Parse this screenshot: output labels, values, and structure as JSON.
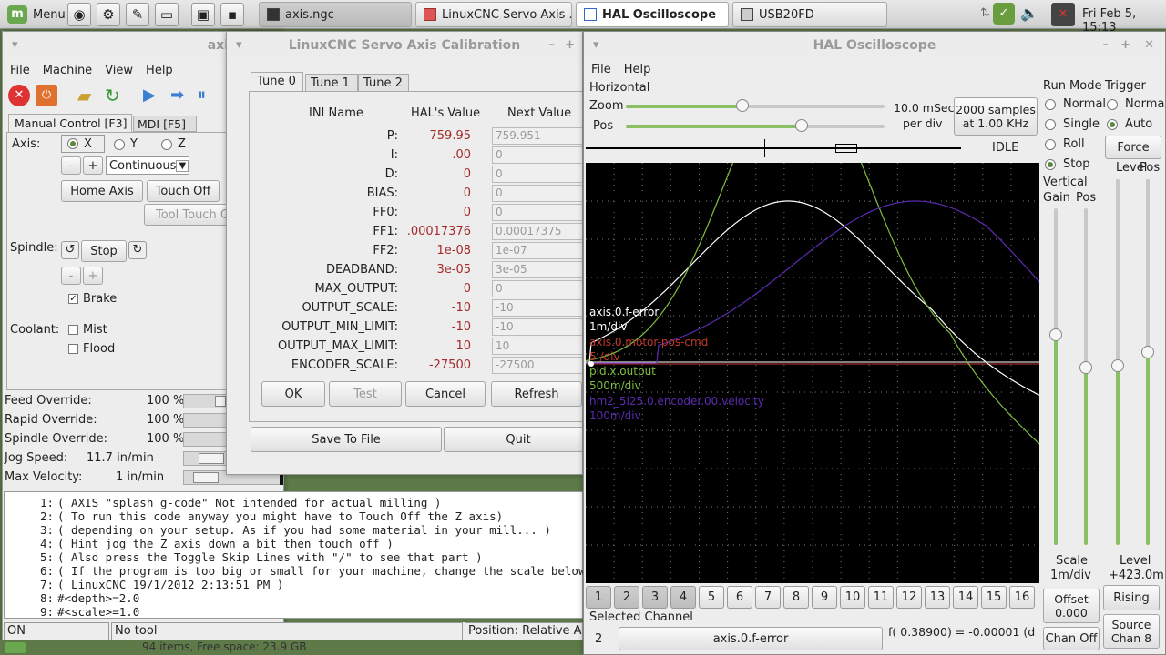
{
  "taskbar": {
    "menu_label": "Menu",
    "windows": [
      {
        "label": "axis.ngc"
      },
      {
        "label": "LinuxCNC Servo Axis ..."
      },
      {
        "label": "HAL Oscilloscope"
      },
      {
        "label": "USB20FD"
      }
    ],
    "clock": "Fri Feb  5, 15:13"
  },
  "axis": {
    "title_fragment": "axi",
    "menu": [
      "File",
      "Machine",
      "View",
      "Help"
    ],
    "tabs": [
      "Manual Control [F3]",
      "MDI [F5]"
    ],
    "axis_label": "Axis:",
    "axes": [
      "X",
      "Y",
      "Z"
    ],
    "jog_minus": "-",
    "jog_plus": "+",
    "jog_mode": "Continuous",
    "home_axis": "Home Axis",
    "touch_off": "Touch Off",
    "tool_touch": "Tool Touch O",
    "spindle_label": "Spindle:",
    "spindle_stop": "Stop",
    "brake": "Brake",
    "coolant_label": "Coolant:",
    "mist": "Mist",
    "flood": "Flood",
    "overrides": [
      {
        "label": "Feed Override:",
        "value": "100 %"
      },
      {
        "label": "Rapid Override:",
        "value": "100 %"
      },
      {
        "label": "Spindle Override:",
        "value": "100 %"
      },
      {
        "label": "Jog Speed:",
        "value": "11.7 in/min"
      },
      {
        "label": "Max Velocity:",
        "value": "1 in/min"
      }
    ],
    "gcode": [
      {
        "n": "1:",
        "t": "( AXIS \"splash g-code\" Not intended for actual milling )"
      },
      {
        "n": "2:",
        "t": "( To run this code anyway you might have to Touch Off the Z axis)"
      },
      {
        "n": "3:",
        "t": "( depending on your setup. As if you had some material in your mill... )"
      },
      {
        "n": "4:",
        "t": "( Hint jog the Z axis down a bit then touch off )"
      },
      {
        "n": "5:",
        "t": "( Also press the Toggle Skip Lines with \"/\" to see that part )"
      },
      {
        "n": "6:",
        "t": "( If the program is too big or small for your machine, change the scale below )"
      },
      {
        "n": "7:",
        "t": "( LinuxCNC 19/1/2012 2:13:51 PM )"
      },
      {
        "n": "8:",
        "t": "#<depth>=2.0"
      },
      {
        "n": "9:",
        "t": "#<scale>=1.0"
      }
    ],
    "status": {
      "state": "ON",
      "tool": "No tool",
      "position": "Position: Relative Actu"
    },
    "bottom_fragment": "94 items, Free space: 23.9 GB"
  },
  "calib": {
    "title": "LinuxCNC Servo Axis Calibration",
    "tabs": [
      "Tune 0",
      "Tune 1",
      "Tune 2"
    ],
    "headers": {
      "name": "INI Name",
      "hal": "HAL's Value",
      "next": "Next Value"
    },
    "rows": [
      {
        "name": "P:",
        "hal": "759.95",
        "next": "759.951"
      },
      {
        "name": "I:",
        "hal": ".00",
        "next": "0"
      },
      {
        "name": "D:",
        "hal": "0",
        "next": "0"
      },
      {
        "name": "BIAS:",
        "hal": "0",
        "next": "0"
      },
      {
        "name": "FF0:",
        "hal": "0",
        "next": "0"
      },
      {
        "name": "FF1:",
        "hal": ".00017376",
        "next": "0.00017375"
      },
      {
        "name": "FF2:",
        "hal": "1e-08",
        "next": "1e-07"
      },
      {
        "name": "DEADBAND:",
        "hal": "3e-05",
        "next": "3e-05"
      },
      {
        "name": "MAX_OUTPUT:",
        "hal": "0",
        "next": "0"
      },
      {
        "name": "OUTPUT_SCALE:",
        "hal": "-10",
        "next": "-10"
      },
      {
        "name": "OUTPUT_MIN_LIMIT:",
        "hal": "-10",
        "next": "-10"
      },
      {
        "name": "OUTPUT_MAX_LIMIT:",
        "hal": "10",
        "next": "10"
      },
      {
        "name": "ENCODER_SCALE:",
        "hal": "-27500",
        "next": "-27500"
      }
    ],
    "buttons": {
      "ok": "OK",
      "test": "Test",
      "cancel": "Cancel",
      "refresh": "Refresh",
      "save": "Save To File",
      "quit": "Quit"
    },
    "colors": {
      "hal_value": "#a52a2a"
    }
  },
  "scope": {
    "title": "HAL Oscilloscope",
    "menu": [
      "File",
      "Help"
    ],
    "horizontal": "Horizontal",
    "zoom": "Zoom",
    "pos": "Pos",
    "zoom_level": 0.45,
    "pos_level": 0.68,
    "timebase_1": "10.0 mSec",
    "timebase_2": "per div",
    "samples_1": "2000 samples",
    "samples_2": "at 1.00 KHz",
    "state": "IDLE",
    "run_mode": {
      "title": "Run Mode",
      "options": [
        "Normal",
        "Single",
        "Roll",
        "Stop"
      ],
      "selected": "Stop"
    },
    "trigger": {
      "title": "Trigger",
      "options": [
        "Normal",
        "Auto"
      ],
      "selected": "Auto",
      "force": "Force"
    },
    "vertical": "Vertical",
    "gain": "Gain",
    "vpos": "Pos",
    "level": "Level",
    "tpos": "Pos",
    "scale_1": "Scale",
    "scale_2": "1m/div",
    "level_1": "Level",
    "level_2": "+423.0m",
    "channels": [
      "1",
      "2",
      "3",
      "4",
      "5",
      "6",
      "7",
      "8",
      "9",
      "10",
      "11",
      "12",
      "13",
      "14",
      "15",
      "16"
    ],
    "active_channels": [
      "1",
      "2",
      "3",
      "4"
    ],
    "selected_channel_label": "Selected Channel",
    "selected_channel_num": "2",
    "selected_channel_name": "axis.0.f-error",
    "offset_1": "Offset",
    "offset_2": "0.000",
    "rising": "Rising",
    "source_1": "Source",
    "source_2": "Chan 8",
    "chan_off": "Chan Off",
    "readout": "f( 0.38900) = -0.00001 (d",
    "traces": [
      {
        "name": "axis.0.f-error",
        "scale": "1m/div",
        "color": "#ffffff"
      },
      {
        "name": "axis.0.motor-pos-cmd",
        "scale": "5 /div",
        "color": "#c0392b"
      },
      {
        "name": "pid.x.output",
        "scale": "500m/div",
        "color": "#7fbf3f"
      },
      {
        "name": "hm2_5i25.0.encoder.00.velocity",
        "scale": "100m/div",
        "color": "#5a2bb0"
      }
    ]
  }
}
